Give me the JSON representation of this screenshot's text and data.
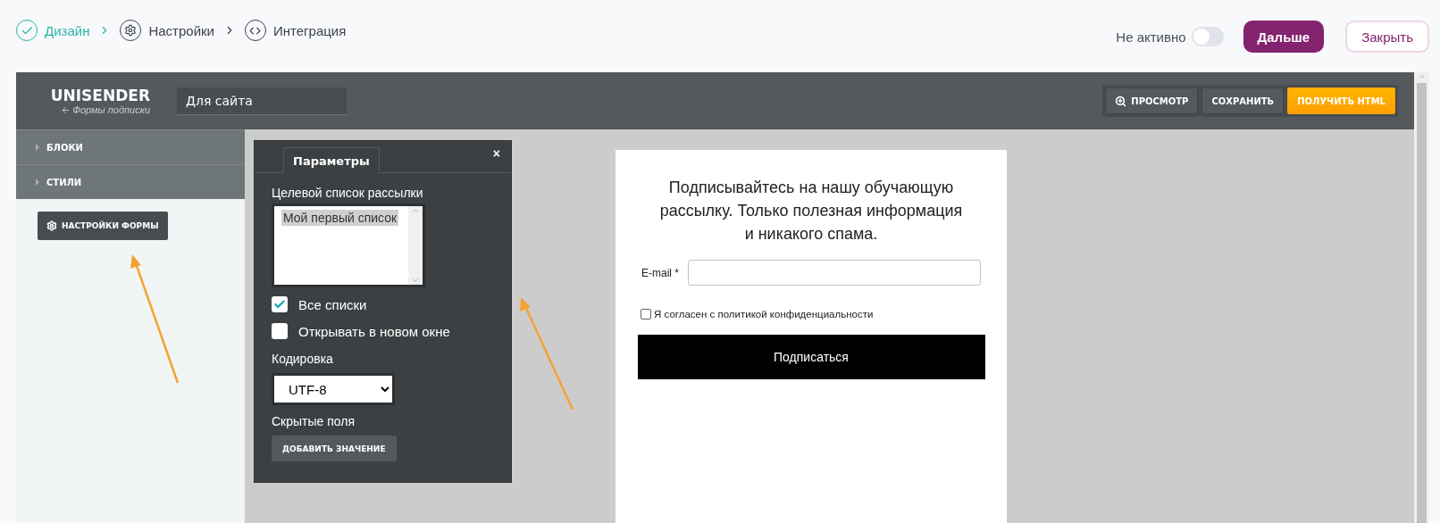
{
  "steps": [
    {
      "label": "Дизайн",
      "kind": "check",
      "done": true
    },
    {
      "label": "Настройки",
      "kind": "gear",
      "done": false
    },
    {
      "label": "Интеграция",
      "kind": "code",
      "done": false
    }
  ],
  "status": {
    "label": "Не активно",
    "on": false
  },
  "actions": {
    "next": "Дальше",
    "close": "Закрыть"
  },
  "editor": {
    "logo": "UNISENDER",
    "back_link": "Формы подписки",
    "form_name": "Для сайта",
    "toolbar": [
      {
        "label": "ПРОСМОТР",
        "kind": "preview"
      },
      {
        "label": "СОХРАНИТЬ",
        "kind": "plain"
      },
      {
        "label": "ПОЛУЧИТЬ HTML",
        "kind": "primary"
      }
    ],
    "sidebar": {
      "sections": [
        {
          "label": "БЛОКИ",
          "expanded": false
        },
        {
          "label": "СТИЛИ",
          "expanded": false
        }
      ],
      "settings_button": "НАСТРОЙКИ ФОРМЫ"
    },
    "panel": {
      "tab": "Параметры",
      "close": "×",
      "list_label": "Целевой список рассылки",
      "lists": [
        {
          "label": "Мой первый список",
          "selected": true
        }
      ],
      "options": [
        {
          "label": "Все списки",
          "checked": true
        },
        {
          "label": "Открывать в новом окне",
          "checked": false
        }
      ],
      "encoding_label": "Кодировка",
      "encoding": "UTF-8",
      "hidden_label": "Скрытые поля",
      "add_button": "ДОБАВИТЬ ЗНАЧЕНИЕ"
    },
    "preview": {
      "heading": "Подписывайтесь на нашу обучающую рассылку. Только полезная информация и никакого спама.",
      "email_label": "E-mail *",
      "consent": {
        "label": "Я согласен с политикой конфиденциальности",
        "checked": false
      },
      "submit": "Подписаться"
    }
  }
}
